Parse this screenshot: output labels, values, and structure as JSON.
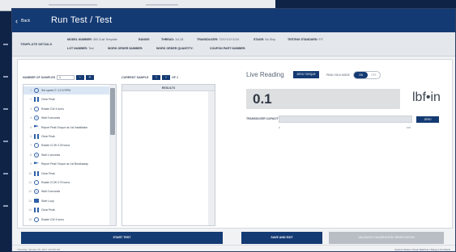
{
  "app": {
    "back_label": "Back",
    "title": "Run Test / Test"
  },
  "details": {
    "section_label": "TEMPLATE DETAILS",
    "fields": [
      {
        "label": "MODEL NUMBER:",
        "value": "360 Cust Template"
      },
      {
        "label": "RANGE:",
        "value": ""
      },
      {
        "label": "THREAD:",
        "value": "1/4-28"
      },
      {
        "label": "TRANSDUCER:",
        "value": "T2/1Y1/1Y1/1/0"
      },
      {
        "label": "STAGE:",
        "value": "No Stop"
      },
      {
        "label": "TESTING STANDARD:",
        "value": "FIT"
      },
      {
        "label": "LOT NUMBER:",
        "value": "Test"
      },
      {
        "label": "WORK ORDER NUMBER:",
        "value": ""
      },
      {
        "label": "WORK ORDER QUANTITY:",
        "value": ""
      },
      {
        "label": "COUPON PART NUMBER:",
        "value": ""
      }
    ]
  },
  "samples": {
    "label": "NUMBER OF SAMPLES",
    "value": "1",
    "current_label": "CURRENT SAMPLE",
    "current_value": "1",
    "of_total": "OF 1"
  },
  "steps": [
    {
      "num": "1",
      "icon": "dial-icon",
      "text": "Set speed 2 / 12.5 RPM"
    },
    {
      "num": "2",
      "icon": "bars-icon",
      "text": "Clear Peak"
    },
    {
      "num": "3",
      "icon": "dial-icon",
      "text": "Rotate CW 4 turns"
    },
    {
      "num": "4",
      "icon": "clock-icon",
      "text": "Wait 3 seconds"
    },
    {
      "num": "5",
      "icon": "flag-icon",
      "text": "Report Peak Torque as 1st Installation"
    },
    {
      "num": "6",
      "icon": "bars-icon",
      "text": "Clear Peak"
    },
    {
      "num": "7",
      "icon": "dial-icon",
      "text": "Rotate CCW 0.25 turns"
    },
    {
      "num": "8",
      "icon": "clock-icon",
      "text": "Wait 1 seconds"
    },
    {
      "num": "9",
      "icon": "flag-icon",
      "text": "Report Peak Torque as 1st Breakaway"
    },
    {
      "num": "10",
      "icon": "bars-icon",
      "text": "Clear Peak"
    },
    {
      "num": "11",
      "icon": "dial-icon",
      "text": "Rotate CCW 3.75 turns"
    },
    {
      "num": "12",
      "icon": "clock-icon",
      "text": "Wait 3 seconds"
    },
    {
      "num": "13",
      "icon": "folder-icon",
      "text": "Start Loop"
    },
    {
      "num": "14",
      "icon": "bars-icon",
      "text": "Clear Peak"
    },
    {
      "num": "15",
      "icon": "dial-icon",
      "text": "Rotate CW 4 turns"
    }
  ],
  "results": {
    "header": "RESULTS"
  },
  "live": {
    "title": "Live Reading",
    "zero_button": "ZERO TORQUE",
    "peak_hold_label": "PEAK HOLD MODE",
    "toggle_on": "ON",
    "toggle_off": "OFF",
    "value": "0.1",
    "unit": "lbf•in",
    "capacity_label": "TRANSDUCER CAPACITY",
    "capacity_min": "0",
    "capacity_max": "100",
    "capacity_fraction": 0.001,
    "zero2_button": "ZERO"
  },
  "buttons": {
    "start": "START TEST",
    "save": "SAVE AND EXIT",
    "calibrate": "VALIDATE CALIBRATION VERIFICATION"
  },
  "footer": {
    "timestamp": "Thursday, January 26, 2017 4:34:56 AM",
    "links": "System Status  |  Setup Machine  |  Range Limit Alerts"
  },
  "colors": {
    "primary": "#143a73",
    "background": "#0f2347"
  }
}
